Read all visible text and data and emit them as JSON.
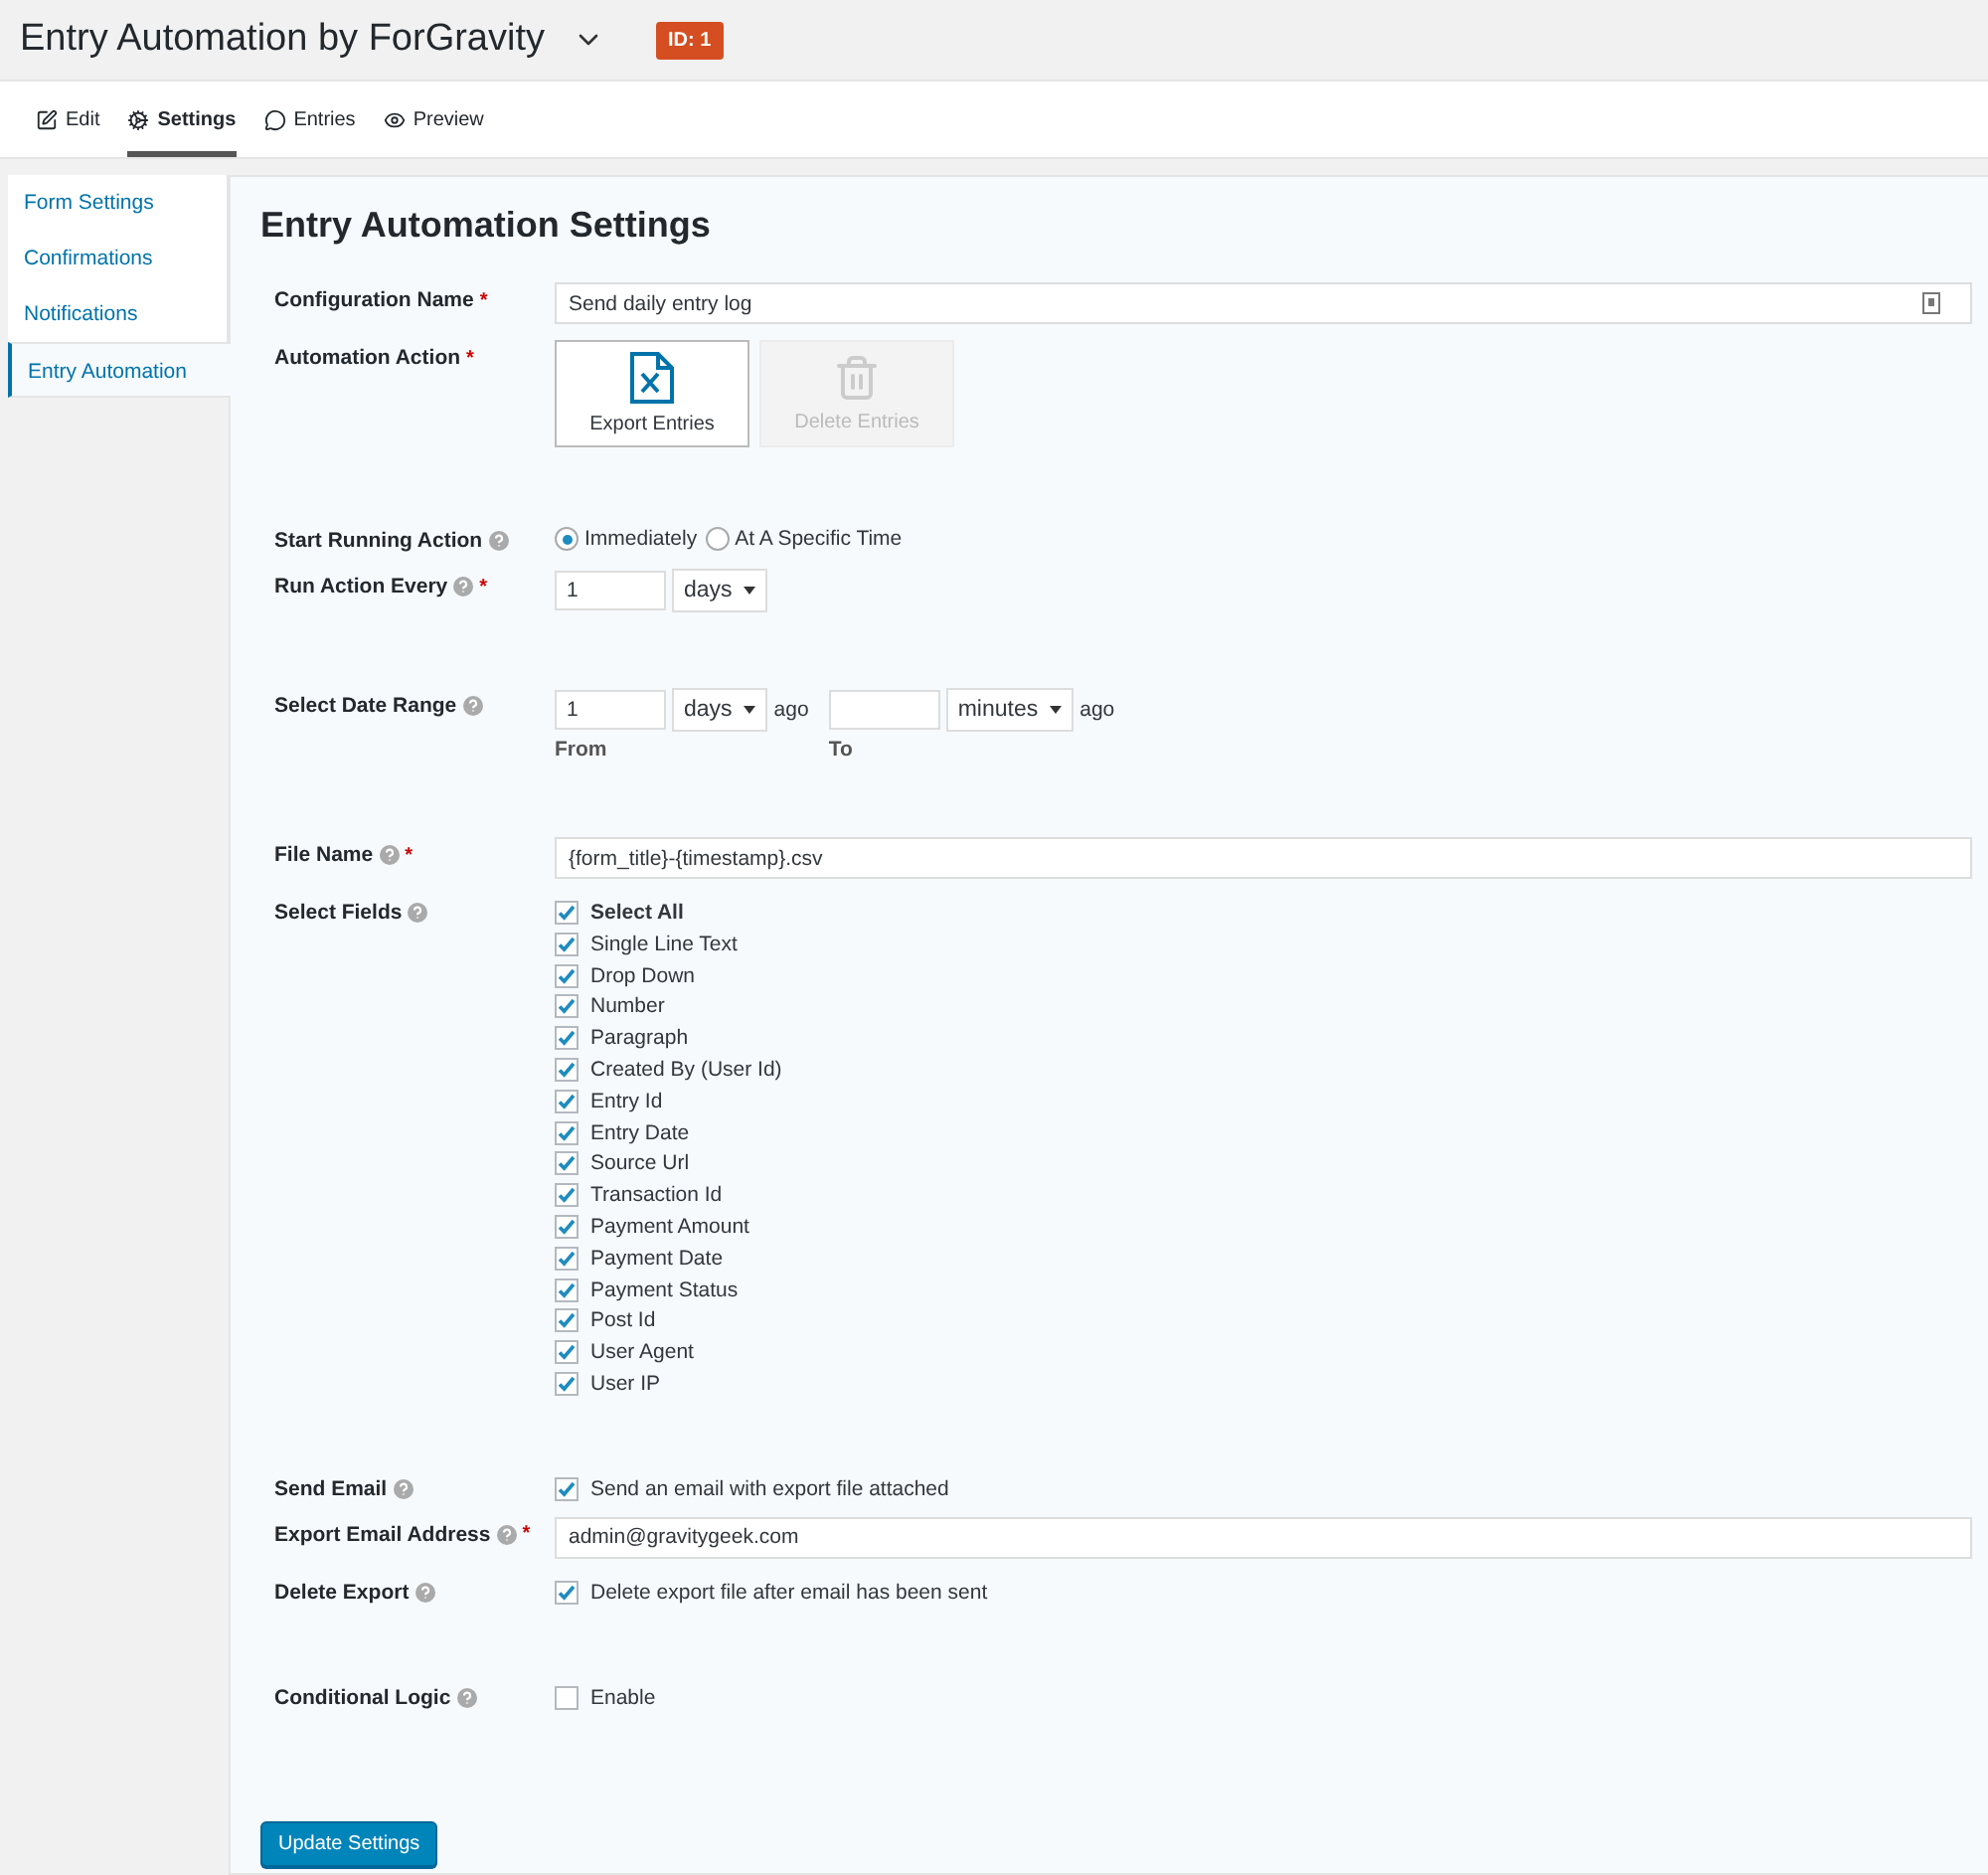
{
  "header": {
    "title": "Entry Automation by ForGravity",
    "badge": "ID: 1"
  },
  "toolbar": [
    {
      "label": "Edit",
      "selected": false
    },
    {
      "label": "Settings",
      "selected": true
    },
    {
      "label": "Entries",
      "selected": false
    },
    {
      "label": "Preview",
      "selected": false
    }
  ],
  "sidebar": {
    "items": [
      {
        "label": "Form Settings",
        "selected": false
      },
      {
        "label": "Confirmations",
        "selected": false
      },
      {
        "label": "Notifications",
        "selected": false
      },
      {
        "label": "Entry Automation",
        "selected": true
      }
    ]
  },
  "settings": {
    "title": "Entry Automation Settings",
    "sections": [
      [
        {
          "kind": "text",
          "label": "Configuration Name",
          "required": "*",
          "help": false,
          "value": "Send daily entry log",
          "addon": true
        },
        {
          "kind": "actions",
          "label": "Automation Action",
          "required": "*",
          "help": false,
          "options": [
            {
              "label": "Export Entries",
              "selected": true,
              "disabled": false
            },
            {
              "label": "Delete Entries",
              "selected": false,
              "disabled": true
            }
          ]
        }
      ],
      [
        {
          "kind": "radio",
          "label": "Start Running Action",
          "help": true,
          "options": [
            {
              "label": "Immediately",
              "selected": true
            },
            {
              "label": "At A Specific Time",
              "selected": false
            }
          ]
        },
        {
          "kind": "interval",
          "label": "Run Action Every",
          "required": "*",
          "help": true,
          "value": "1",
          "unit": "days"
        }
      ],
      [
        {
          "kind": "range",
          "label": "Select Date Range",
          "help": true,
          "parts": [
            {
              "value": "1",
              "unit": "days",
              "suffix": "ago",
              "caption": "From"
            },
            {
              "unit": "minutes",
              "suffix": "ago",
              "caption": "To"
            }
          ]
        }
      ],
      [
        {
          "kind": "text",
          "label": "File Name",
          "required": "*",
          "help": true,
          "value": "{form_title}-{timestamp}.csv",
          "addon": false
        },
        {
          "kind": "checklist",
          "label": "Select Fields",
          "help": true,
          "items": [
            {
              "label": "Select All",
              "checked": true,
              "kind": "all"
            },
            {
              "label": "Single Line Text",
              "checked": true,
              "kind": "field"
            },
            {
              "label": "Drop Down",
              "checked": true,
              "kind": "field"
            },
            {
              "label": "Number",
              "checked": true,
              "kind": "field"
            },
            {
              "label": "Paragraph",
              "checked": true,
              "kind": "field"
            },
            {
              "label": "Created By (User Id)",
              "checked": true,
              "kind": "field"
            },
            {
              "label": "Entry Id",
              "checked": true,
              "kind": "field"
            },
            {
              "label": "Entry Date",
              "checked": true,
              "kind": "field"
            },
            {
              "label": "Source Url",
              "checked": true,
              "kind": "field"
            },
            {
              "label": "Transaction Id",
              "checked": true,
              "kind": "field"
            },
            {
              "label": "Payment Amount",
              "checked": true,
              "kind": "field"
            },
            {
              "label": "Payment Date",
              "checked": true,
              "kind": "field"
            },
            {
              "label": "Payment Status",
              "checked": true,
              "kind": "field"
            },
            {
              "label": "Post Id",
              "checked": true,
              "kind": "field"
            },
            {
              "label": "User Agent",
              "checked": true,
              "kind": "field"
            },
            {
              "label": "User IP",
              "checked": true,
              "kind": "field"
            }
          ]
        }
      ],
      [
        {
          "kind": "checkbox",
          "label": "Send Email",
          "help": true,
          "text": "Send an email with export file attached",
          "checked": true
        },
        {
          "kind": "text",
          "label": "Export Email Address",
          "required": "*",
          "help": true,
          "value": "admin@gravitygeek.com",
          "addon": false
        },
        {
          "kind": "checkbox",
          "label": "Delete Export",
          "help": true,
          "text": "Delete export file after email has been sent",
          "checked": true
        }
      ],
      [
        {
          "kind": "checkbox",
          "label": "Conditional Logic",
          "help": true,
          "text": "Enable",
          "checked": false
        }
      ]
    ],
    "button": "Update Settings"
  }
}
